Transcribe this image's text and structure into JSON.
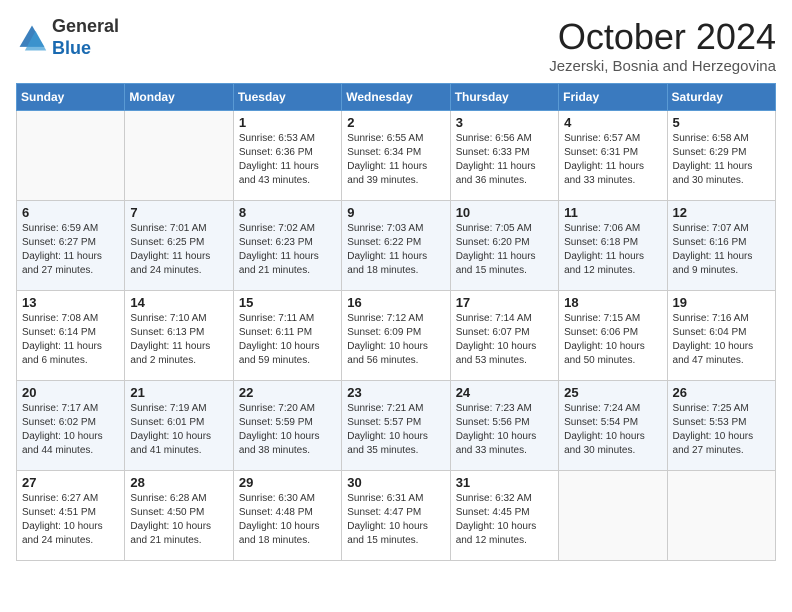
{
  "header": {
    "logo_general": "General",
    "logo_blue": "Blue",
    "month_title": "October 2024",
    "subtitle": "Jezerski, Bosnia and Herzegovina"
  },
  "days_of_week": [
    "Sunday",
    "Monday",
    "Tuesday",
    "Wednesday",
    "Thursday",
    "Friday",
    "Saturday"
  ],
  "weeks": [
    [
      {
        "day": "",
        "sunrise": "",
        "sunset": "",
        "daylight": ""
      },
      {
        "day": "",
        "sunrise": "",
        "sunset": "",
        "daylight": ""
      },
      {
        "day": "1",
        "sunrise": "Sunrise: 6:53 AM",
        "sunset": "Sunset: 6:36 PM",
        "daylight": "Daylight: 11 hours and 43 minutes."
      },
      {
        "day": "2",
        "sunrise": "Sunrise: 6:55 AM",
        "sunset": "Sunset: 6:34 PM",
        "daylight": "Daylight: 11 hours and 39 minutes."
      },
      {
        "day": "3",
        "sunrise": "Sunrise: 6:56 AM",
        "sunset": "Sunset: 6:33 PM",
        "daylight": "Daylight: 11 hours and 36 minutes."
      },
      {
        "day": "4",
        "sunrise": "Sunrise: 6:57 AM",
        "sunset": "Sunset: 6:31 PM",
        "daylight": "Daylight: 11 hours and 33 minutes."
      },
      {
        "day": "5",
        "sunrise": "Sunrise: 6:58 AM",
        "sunset": "Sunset: 6:29 PM",
        "daylight": "Daylight: 11 hours and 30 minutes."
      }
    ],
    [
      {
        "day": "6",
        "sunrise": "Sunrise: 6:59 AM",
        "sunset": "Sunset: 6:27 PM",
        "daylight": "Daylight: 11 hours and 27 minutes."
      },
      {
        "day": "7",
        "sunrise": "Sunrise: 7:01 AM",
        "sunset": "Sunset: 6:25 PM",
        "daylight": "Daylight: 11 hours and 24 minutes."
      },
      {
        "day": "8",
        "sunrise": "Sunrise: 7:02 AM",
        "sunset": "Sunset: 6:23 PM",
        "daylight": "Daylight: 11 hours and 21 minutes."
      },
      {
        "day": "9",
        "sunrise": "Sunrise: 7:03 AM",
        "sunset": "Sunset: 6:22 PM",
        "daylight": "Daylight: 11 hours and 18 minutes."
      },
      {
        "day": "10",
        "sunrise": "Sunrise: 7:05 AM",
        "sunset": "Sunset: 6:20 PM",
        "daylight": "Daylight: 11 hours and 15 minutes."
      },
      {
        "day": "11",
        "sunrise": "Sunrise: 7:06 AM",
        "sunset": "Sunset: 6:18 PM",
        "daylight": "Daylight: 11 hours and 12 minutes."
      },
      {
        "day": "12",
        "sunrise": "Sunrise: 7:07 AM",
        "sunset": "Sunset: 6:16 PM",
        "daylight": "Daylight: 11 hours and 9 minutes."
      }
    ],
    [
      {
        "day": "13",
        "sunrise": "Sunrise: 7:08 AM",
        "sunset": "Sunset: 6:14 PM",
        "daylight": "Daylight: 11 hours and 6 minutes."
      },
      {
        "day": "14",
        "sunrise": "Sunrise: 7:10 AM",
        "sunset": "Sunset: 6:13 PM",
        "daylight": "Daylight: 11 hours and 2 minutes."
      },
      {
        "day": "15",
        "sunrise": "Sunrise: 7:11 AM",
        "sunset": "Sunset: 6:11 PM",
        "daylight": "Daylight: 10 hours and 59 minutes."
      },
      {
        "day": "16",
        "sunrise": "Sunrise: 7:12 AM",
        "sunset": "Sunset: 6:09 PM",
        "daylight": "Daylight: 10 hours and 56 minutes."
      },
      {
        "day": "17",
        "sunrise": "Sunrise: 7:14 AM",
        "sunset": "Sunset: 6:07 PM",
        "daylight": "Daylight: 10 hours and 53 minutes."
      },
      {
        "day": "18",
        "sunrise": "Sunrise: 7:15 AM",
        "sunset": "Sunset: 6:06 PM",
        "daylight": "Daylight: 10 hours and 50 minutes."
      },
      {
        "day": "19",
        "sunrise": "Sunrise: 7:16 AM",
        "sunset": "Sunset: 6:04 PM",
        "daylight": "Daylight: 10 hours and 47 minutes."
      }
    ],
    [
      {
        "day": "20",
        "sunrise": "Sunrise: 7:17 AM",
        "sunset": "Sunset: 6:02 PM",
        "daylight": "Daylight: 10 hours and 44 minutes."
      },
      {
        "day": "21",
        "sunrise": "Sunrise: 7:19 AM",
        "sunset": "Sunset: 6:01 PM",
        "daylight": "Daylight: 10 hours and 41 minutes."
      },
      {
        "day": "22",
        "sunrise": "Sunrise: 7:20 AM",
        "sunset": "Sunset: 5:59 PM",
        "daylight": "Daylight: 10 hours and 38 minutes."
      },
      {
        "day": "23",
        "sunrise": "Sunrise: 7:21 AM",
        "sunset": "Sunset: 5:57 PM",
        "daylight": "Daylight: 10 hours and 35 minutes."
      },
      {
        "day": "24",
        "sunrise": "Sunrise: 7:23 AM",
        "sunset": "Sunset: 5:56 PM",
        "daylight": "Daylight: 10 hours and 33 minutes."
      },
      {
        "day": "25",
        "sunrise": "Sunrise: 7:24 AM",
        "sunset": "Sunset: 5:54 PM",
        "daylight": "Daylight: 10 hours and 30 minutes."
      },
      {
        "day": "26",
        "sunrise": "Sunrise: 7:25 AM",
        "sunset": "Sunset: 5:53 PM",
        "daylight": "Daylight: 10 hours and 27 minutes."
      }
    ],
    [
      {
        "day": "27",
        "sunrise": "Sunrise: 6:27 AM",
        "sunset": "Sunset: 4:51 PM",
        "daylight": "Daylight: 10 hours and 24 minutes."
      },
      {
        "day": "28",
        "sunrise": "Sunrise: 6:28 AM",
        "sunset": "Sunset: 4:50 PM",
        "daylight": "Daylight: 10 hours and 21 minutes."
      },
      {
        "day": "29",
        "sunrise": "Sunrise: 6:30 AM",
        "sunset": "Sunset: 4:48 PM",
        "daylight": "Daylight: 10 hours and 18 minutes."
      },
      {
        "day": "30",
        "sunrise": "Sunrise: 6:31 AM",
        "sunset": "Sunset: 4:47 PM",
        "daylight": "Daylight: 10 hours and 15 minutes."
      },
      {
        "day": "31",
        "sunrise": "Sunrise: 6:32 AM",
        "sunset": "Sunset: 4:45 PM",
        "daylight": "Daylight: 10 hours and 12 minutes."
      },
      {
        "day": "",
        "sunrise": "",
        "sunset": "",
        "daylight": ""
      },
      {
        "day": "",
        "sunrise": "",
        "sunset": "",
        "daylight": ""
      }
    ]
  ]
}
